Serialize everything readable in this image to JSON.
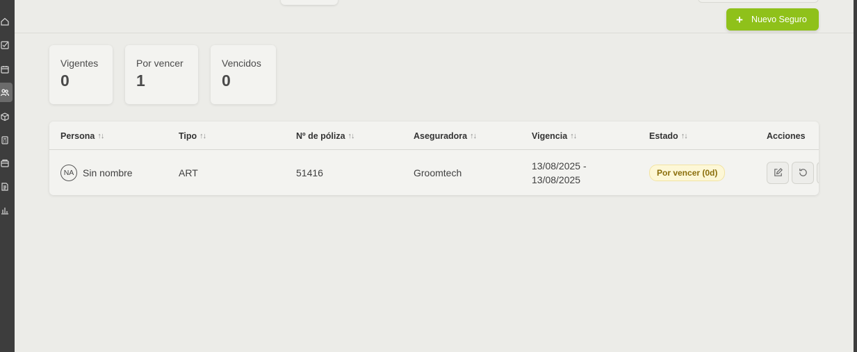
{
  "header": {
    "new_button_label": "Nuevo Seguro",
    "new_button_icon": "plus-icon"
  },
  "sidebar": {
    "items": [
      {
        "icon": "home-icon"
      },
      {
        "icon": "checklist-icon"
      },
      {
        "icon": "calendar-icon"
      },
      {
        "icon": "users-icon",
        "active": true
      },
      {
        "icon": "box-icon"
      },
      {
        "icon": "calculator-icon"
      },
      {
        "icon": "wallet-icon"
      },
      {
        "icon": "document-icon"
      },
      {
        "icon": "bar-chart-icon"
      }
    ]
  },
  "stats": [
    {
      "label": "Vigentes",
      "value": "0"
    },
    {
      "label": "Por vencer",
      "value": "1"
    },
    {
      "label": "Vencidos",
      "value": "0"
    }
  ],
  "table": {
    "columns": [
      {
        "label": "Persona",
        "sortable": true
      },
      {
        "label": "Tipo",
        "sortable": true
      },
      {
        "label": "Nº de póliza",
        "sortable": true
      },
      {
        "label": "Aseguradora",
        "sortable": true
      },
      {
        "label": "Vigencia",
        "sortable": true
      },
      {
        "label": "Estado",
        "sortable": true
      },
      {
        "label": "Acciones",
        "sortable": false
      }
    ],
    "sort_glyph": "↑↓",
    "rows": [
      {
        "avatar_initials": "NA",
        "persona": "Sin nombre",
        "tipo": "ART",
        "poliza": "51416",
        "aseguradora": "Groomtech",
        "vigencia_start": "13/08/2025 -",
        "vigencia_end": "13/08/2025",
        "estado": "Por vencer (0d)",
        "actions": [
          "edit-icon",
          "renew-icon"
        ]
      }
    ]
  },
  "colors": {
    "accent": "#8fc11a",
    "sidebar": "#3d3d3d",
    "background": "#ecece8",
    "badge_bg": "#fdf7d6",
    "badge_text": "#8a6d0a"
  }
}
